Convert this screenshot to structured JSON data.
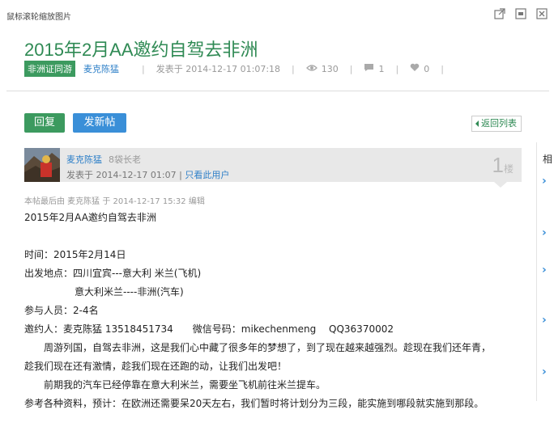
{
  "topbar": {
    "hint": "鼠标滚轮缩放图片",
    "icons": [
      "popout-icon",
      "minimize-icon",
      "close-icon"
    ]
  },
  "post": {
    "title": "2015年2月AA邀约自驾去非洲",
    "tag": "非洲证同游",
    "author": "麦克陈猛",
    "posted_label": "发表于 2014-12-17 01:07:18",
    "views": "130",
    "comments": "1",
    "likes": "0"
  },
  "actions": {
    "reply": "回复",
    "new_post": "发新帖",
    "back": "返回列表"
  },
  "floor": {
    "username": "麦克陈猛",
    "rank": "8袋长老",
    "posted": "发表于 2014-12-17 01:07",
    "divider": "|",
    "only_author": "只看此用户",
    "number": "1",
    "unit": "楼",
    "edited": "本帖最后由 麦克陈猛 于 2014-12-17 15:32 编辑"
  },
  "content": {
    "lines": [
      "2015年2月AA邀约自驾去非洲",
      "",
      "时间：2015年2月14日",
      "出发地点：四川宜宾---意大利 米兰(飞机)",
      "意大利米兰----非洲(汽车)",
      "参与人员：2-4名",
      "邀约人：麦克陈猛 13518451734　　微信号码：mikechenmeng　 QQ36370002",
      "周游列国，自驾去非洲，这是我们心中藏了很多年的梦想了，到了现在越来越强烈。趁现在我们还年青，",
      "趁我们现在还有激情，趁我们现在还跑的动，让我们出发吧！",
      "前期我的汽车已经停靠在意大利米兰，需要坐飞机前往米兰提车。",
      "参考各种资料，预计：在欧洲还需要呆20天左右，我们暂时将计划分为三段，能实施到哪段就实施到那段。"
    ]
  },
  "sidebar": {
    "header": "相"
  },
  "colors": {
    "accent_green": "#3c9a5f",
    "accent_blue": "#3a8fd8",
    "link_blue": "#2f80c8"
  }
}
